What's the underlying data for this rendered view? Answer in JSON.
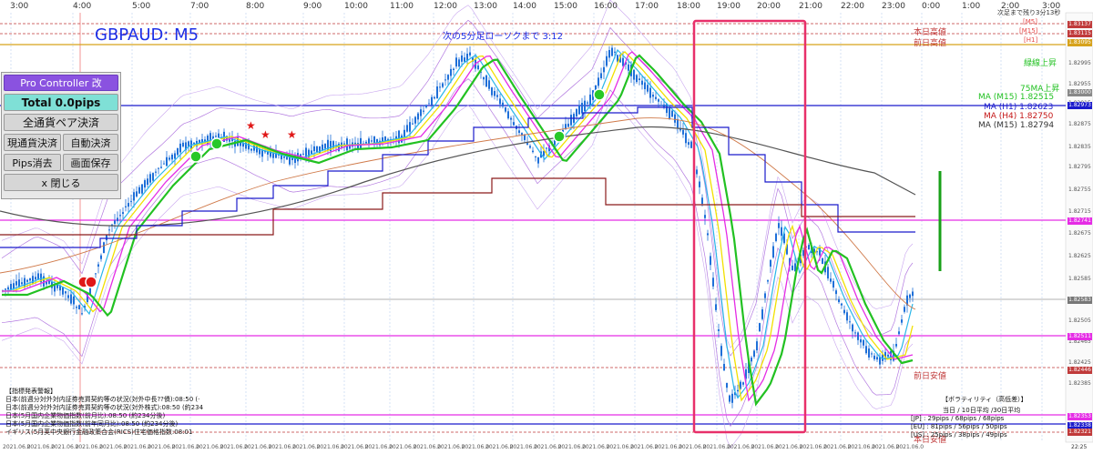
{
  "header": {
    "symbol_label": "GBPAUD: M5",
    "countdown": "次の5分足ローソクまで 3:12",
    "remaining": "次足まで残り3分13秒"
  },
  "top_axis": {
    "labels": [
      "3:00",
      "4:00",
      "5:00",
      "7:00",
      "8:00",
      "9:00",
      "10:00",
      "11:00",
      "12:00",
      "13:00",
      "14:00",
      "15:00",
      "16:00",
      "17:00",
      "18:00",
      "19:00",
      "20:00",
      "21:00",
      "22:00",
      "23:00",
      "0:00",
      "1:00",
      "2:00",
      "3:00"
    ]
  },
  "tf_markers": [
    {
      "text": "[M5]",
      "color": "#e64a4a"
    },
    {
      "text": "[M15]",
      "color": "#e64a4a"
    },
    {
      "text": "[H1]",
      "color": "#e64a4a"
    }
  ],
  "level_labels": {
    "today_high": "本日高値",
    "prev_high": "前日高値",
    "trend_up": "緑線上昇",
    "ma75_up": "75MA上昇",
    "prev_low": "前日安値",
    "today_low": "本日安値"
  },
  "ma_legend": [
    {
      "text": "MA (M15) 1.82515",
      "color": "#22c122"
    },
    {
      "text": "MA (H1) 1.82623",
      "color": "#1b1bcc"
    },
    {
      "text": "MA (H4) 1.82750",
      "color": "#c41616"
    },
    {
      "text": "MA (M15) 1.82794",
      "color": "#333333"
    }
  ],
  "price_axis": {
    "labels": [
      "1.83137",
      "1.83115",
      "1.83095",
      "1.82995",
      "1.82955",
      "1.82915",
      "1.82875",
      "1.82835",
      "1.82795",
      "1.82755",
      "1.82715",
      "1.82675",
      "1.82625",
      "1.82585",
      "1.82545",
      "1.82505",
      "1.82465",
      "1.82425",
      "1.82385"
    ],
    "tags": [
      {
        "text": "1.83137",
        "color": "#c03a3a"
      },
      {
        "text": "1.83115",
        "color": "#c03a3a"
      },
      {
        "text": "1.83095",
        "color": "#d6a21b"
      },
      {
        "text": "1.83000",
        "color": "#888888"
      },
      {
        "text": "1.82973",
        "color": "#1b1bcc"
      },
      {
        "text": "1.82741",
        "color": "#e52ce5"
      },
      {
        "text": "1.82583",
        "color": "#777777"
      },
      {
        "text": "1.82511",
        "color": "#e52ce5"
      },
      {
        "text": "1.82446",
        "color": "#c03a3a"
      },
      {
        "text": "1.82353",
        "color": "#e52ce5"
      },
      {
        "text": "1.82338",
        "color": "#1b1bcc"
      },
      {
        "text": "1.82321",
        "color": "#c03a3a"
      }
    ]
  },
  "panel": {
    "title": "Pro Controller 改",
    "total": "Total   0.0pips",
    "close_all_pairs": "全通貨ペア決済",
    "close_current": "現通貨決済",
    "auto_close": "自動決済",
    "pips_clear": "Pips消去",
    "save_screen": "画面保存",
    "close": "x 閉じる"
  },
  "news": {
    "title": "【指標発表警報】",
    "lines": [
      "日本(前週分対外対内証券売買契約等の状況(対外中長??債):08:50 (·",
      "日本(前週分対外対内証券売買契約等の状況(対外株式):08:50 (約234",
      "日本(5月国内企業物価指数(前月比):08:50 (約234分後)",
      "日本(5月国内企業物価指数(前年同月比):08:50 (約234分後)",
      "イギリス(5月英中央銀行金融政策合会(RICS)住宅価格指数:08:01"
    ]
  },
  "volatility": {
    "title": "【ボラティリティ（高低差）】",
    "header": "当日 / 10日平均 /30日平均",
    "rows": [
      "[JP] : 29pips / 68pips / 68pips",
      "[EU] : 81pips / 56pips / 50pips",
      "[US] : 25pips / 38pips / 49pips"
    ]
  },
  "bottom_axis": {
    "date_label": "2021.06.0",
    "time_label": "22:25"
  },
  "colors": {
    "bull": "#1e6fd8",
    "bear": "#1e6fd8",
    "ma_green": "#22c122",
    "ma_yellow": "#f2e000",
    "ma_magenta": "#e52ce5",
    "ma_cyan": "#29b6e9",
    "ma_blue": "#1b1bcc",
    "ma_red": "#8b1a1a",
    "ma_gray": "#444444",
    "highlight": "#e8306a"
  }
}
